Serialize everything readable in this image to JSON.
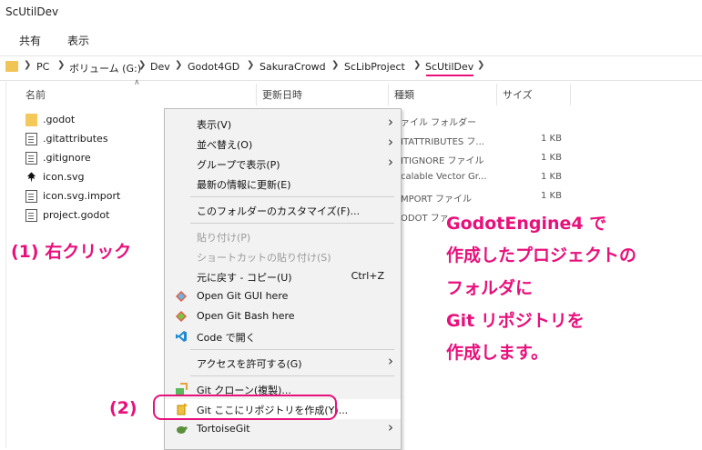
{
  "window": {
    "title": "ScUtilDev"
  },
  "ribbon": {
    "tabs": [
      "共有",
      "表示"
    ]
  },
  "breadcrumb": [
    "PC",
    "ボリューム (G:)",
    "Dev",
    "Godot4GD",
    "SakuraCrowd",
    "ScLibProject",
    "ScUtilDev"
  ],
  "columns": {
    "name": "名前",
    "date": "更新日時",
    "type": "種類",
    "size": "サイズ"
  },
  "files": [
    {
      "name": ".godot",
      "icon": "folder-icon",
      "type": "ァイル フォルダー",
      "size": ""
    },
    {
      "name": ".gitattributes",
      "icon": "text-file-icon",
      "type": "ITATTRIBUTES フ...",
      "size": "1 KB"
    },
    {
      "name": ".gitignore",
      "icon": "text-file-icon",
      "type": "ITIGNORE ファイル",
      "size": "1 KB"
    },
    {
      "name": "icon.svg",
      "icon": "inkscape-icon",
      "type": "calable Vector Gr...",
      "size": "1 KB"
    },
    {
      "name": "icon.svg.import",
      "icon": "file-icon",
      "type": "MPORT ファイル",
      "size": "1 KB"
    },
    {
      "name": "project.godot",
      "icon": "text-file-icon",
      "type": "ODOT ファ",
      "size": ""
    }
  ],
  "context_menu": {
    "view": "表示(V)",
    "sort": "並べ替え(O)",
    "group": "グループで表示(P)",
    "refresh": "最新の情報に更新(E)",
    "customize": "このフォルダーのカスタマイズ(F)...",
    "paste": "貼り付け(P)",
    "paste_shortcut": "ショートカットの貼り付け(S)",
    "undo": "元に戻す - コピー(U)",
    "undo_shortcut": "Ctrl+Z",
    "git_gui": "Open Git GUI here",
    "git_bash": "Open Git Bash here",
    "vscode": "Code で開く",
    "access": "アクセスを許可する(G)",
    "git_clone": "Git クローン(複製)...",
    "git_create": "Git ここにリポジトリを作成(Y)...",
    "tortoise": "TortoiseGit"
  },
  "annotations": {
    "step1": "(1) 右クリック",
    "step2": "(2)",
    "note_lines": [
      "GodotEngine4 で",
      "作成したプロジェクトの",
      "フォルダに",
      "Git リポジトリを",
      "作成します。"
    ]
  },
  "colors": {
    "accent": "#e8107b",
    "menu_bg": "#f2f2f2",
    "folder": "#f4c95a"
  }
}
